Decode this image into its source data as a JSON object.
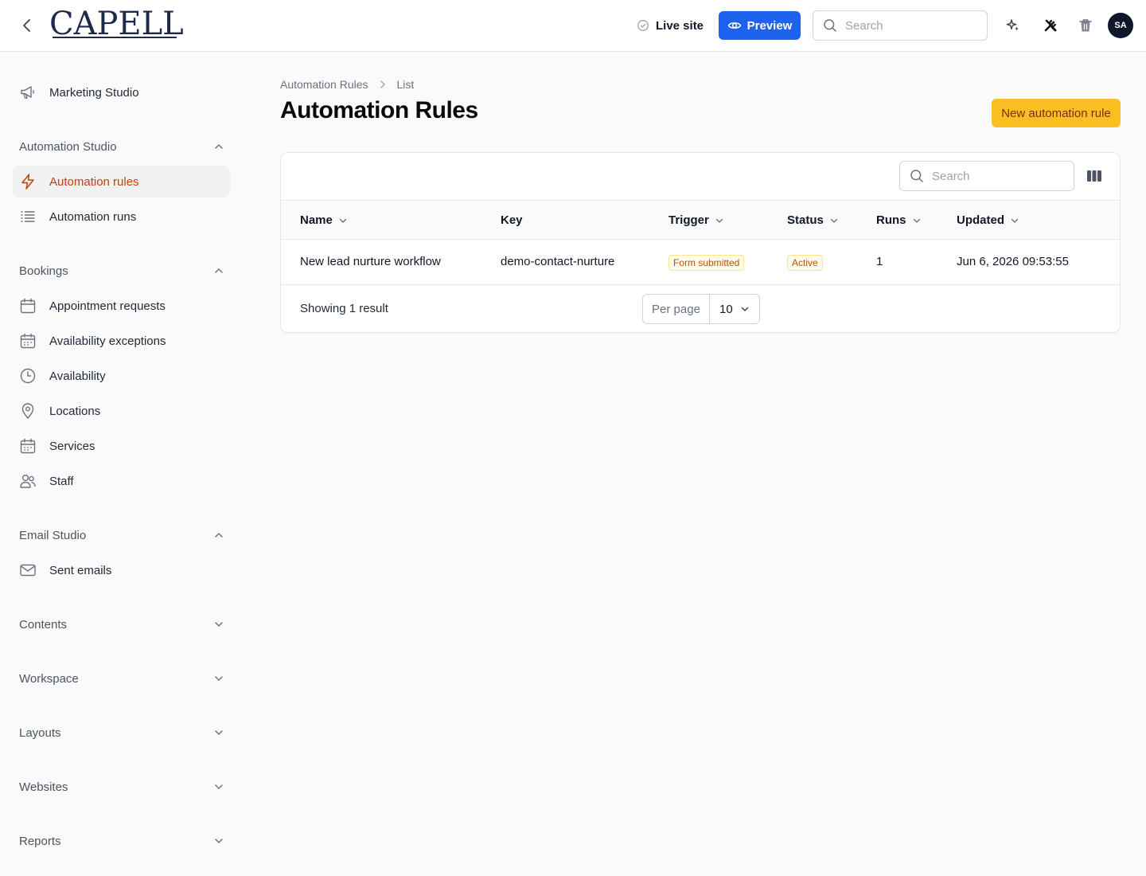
{
  "header": {
    "logo_text": "CAPELL",
    "live_site_label": "Live site",
    "preview_label": "Preview",
    "search_placeholder": "Search",
    "avatar_initials": "SA",
    "brand_color": "#1d63ed"
  },
  "sidebar": {
    "top_item": "Marketing Studio",
    "groups": [
      {
        "label": "Automation Studio",
        "expanded": true,
        "items": [
          {
            "label": "Automation rules",
            "icon": "bolt-icon",
            "active": true
          },
          {
            "label": "Automation runs",
            "icon": "list-icon",
            "active": false
          }
        ]
      },
      {
        "label": "Bookings",
        "expanded": true,
        "items": [
          {
            "label": "Appointment requests",
            "icon": "calendar-icon"
          },
          {
            "label": "Availability exceptions",
            "icon": "calendar-days-icon"
          },
          {
            "label": "Availability",
            "icon": "clock-icon"
          },
          {
            "label": "Locations",
            "icon": "map-pin-icon"
          },
          {
            "label": "Services",
            "icon": "calendar-days-icon"
          },
          {
            "label": "Staff",
            "icon": "users-icon"
          }
        ]
      },
      {
        "label": "Email Studio",
        "expanded": true,
        "items": [
          {
            "label": "Sent emails",
            "icon": "envelope-icon"
          }
        ]
      },
      {
        "label": "Contents",
        "expanded": false,
        "items": []
      },
      {
        "label": "Workspace",
        "expanded": false,
        "items": []
      },
      {
        "label": "Layouts",
        "expanded": false,
        "items": []
      },
      {
        "label": "Websites",
        "expanded": false,
        "items": []
      },
      {
        "label": "Reports",
        "expanded": false,
        "items": []
      }
    ],
    "active_color": "#c2410c"
  },
  "main": {
    "breadcrumb": [
      "Automation Rules",
      "List"
    ],
    "title": "Automation Rules",
    "new_button_label": "New automation rule",
    "accent_color": "#fbbf24",
    "table": {
      "search_placeholder": "Search",
      "columns": [
        "Name",
        "Key",
        "Trigger",
        "Status",
        "Runs",
        "Updated"
      ],
      "rows": [
        {
          "name": "New lead nurture workflow",
          "key": "demo-contact-nurture",
          "trigger": "Form submitted",
          "status": "Active",
          "runs": "1",
          "updated": "Jun 6, 2026 09:53:55"
        }
      ],
      "footer_text": "Showing 1 result",
      "per_page_label": "Per page",
      "per_page_value": "10"
    }
  }
}
